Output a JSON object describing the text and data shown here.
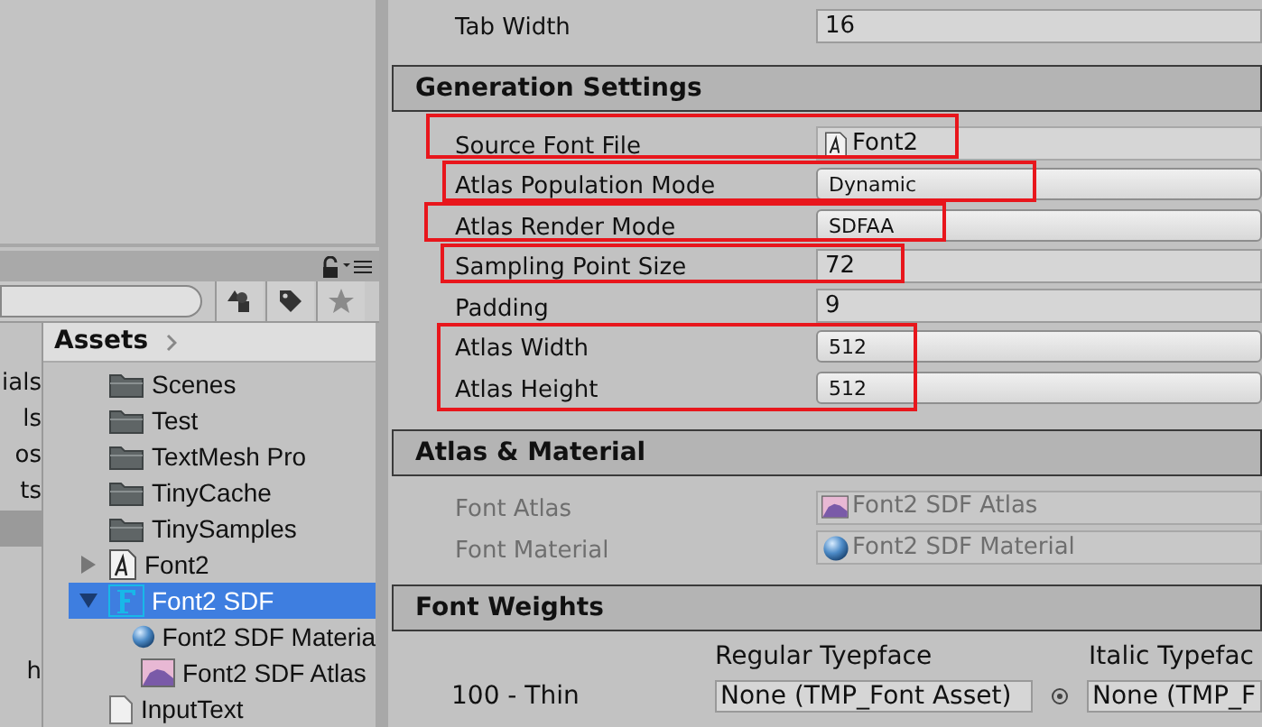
{
  "left_strip": [
    {
      "text": "ials",
      "selected": false
    },
    {
      "text": "ls",
      "selected": false
    },
    {
      "text": "os",
      "selected": false
    },
    {
      "text": "ts",
      "selected": false
    },
    {
      "selected": true
    },
    {
      "text": "h",
      "selected": false
    }
  ],
  "assets_panel": {
    "title": "Assets",
    "items": [
      {
        "name": "Scenes",
        "kind": "folder",
        "selected": false
      },
      {
        "name": "Test",
        "kind": "folder",
        "selected": false
      },
      {
        "name": "TextMesh Pro",
        "kind": "folder",
        "selected": false
      },
      {
        "name": "TinyCache",
        "kind": "folder",
        "selected": false
      },
      {
        "name": "TinySamples",
        "kind": "folder",
        "selected": false
      },
      {
        "name": "Font2",
        "kind": "font",
        "selected": false,
        "expanded": false
      },
      {
        "name": "Font2 SDF",
        "kind": "fontasset",
        "selected": true,
        "expanded": true,
        "children": [
          {
            "name": "Font2 SDF Materia",
            "kind": "material",
            "selected": false
          },
          {
            "name": "Font2 SDF Atlas",
            "kind": "texture",
            "selected": false
          }
        ]
      },
      {
        "name": "InputText",
        "kind": "file",
        "selected": false
      }
    ]
  },
  "inspector": {
    "top_row": {
      "label": "Tab Width",
      "value": "16",
      "kind": "number",
      "disabled": false
    },
    "sections": [
      {
        "title": "Generation Settings",
        "rows": [
          {
            "label": "Source Font File",
            "value": "Font2",
            "kind": "fontref",
            "disabled": false
          },
          {
            "label": "Atlas Population Mode",
            "value": "Dynamic",
            "kind": "dropdown",
            "disabled": false
          },
          {
            "label": "Atlas Render Mode",
            "value": "SDFAA",
            "kind": "dropdown",
            "disabled": false
          },
          {
            "label": "Sampling Point Size",
            "value": "72",
            "kind": "number",
            "disabled": false
          },
          {
            "label": "Padding",
            "value": "9",
            "kind": "number",
            "disabled": false
          },
          {
            "label": "Atlas Width",
            "value": "512",
            "kind": "dropdown",
            "disabled": false
          },
          {
            "label": "Atlas Height",
            "value": "512",
            "kind": "dropdown",
            "disabled": false
          }
        ]
      },
      {
        "title": "Atlas & Material",
        "rows": [
          {
            "label": "Font Atlas",
            "value": "Font2 SDF Atlas",
            "kind": "textureref",
            "disabled": true
          },
          {
            "label": "Font Material",
            "value": "Font2 SDF Material",
            "kind": "materialref",
            "disabled": true
          }
        ]
      },
      {
        "title": "Font Weights",
        "columns": [
          "Regular Tyepface",
          "Italic Typefac"
        ],
        "weight_rows": [
          {
            "label": "100 - Thin",
            "values": [
              "None (TMP_Font Asset)",
              "None (TMP_F"
            ]
          }
        ]
      }
    ]
  }
}
